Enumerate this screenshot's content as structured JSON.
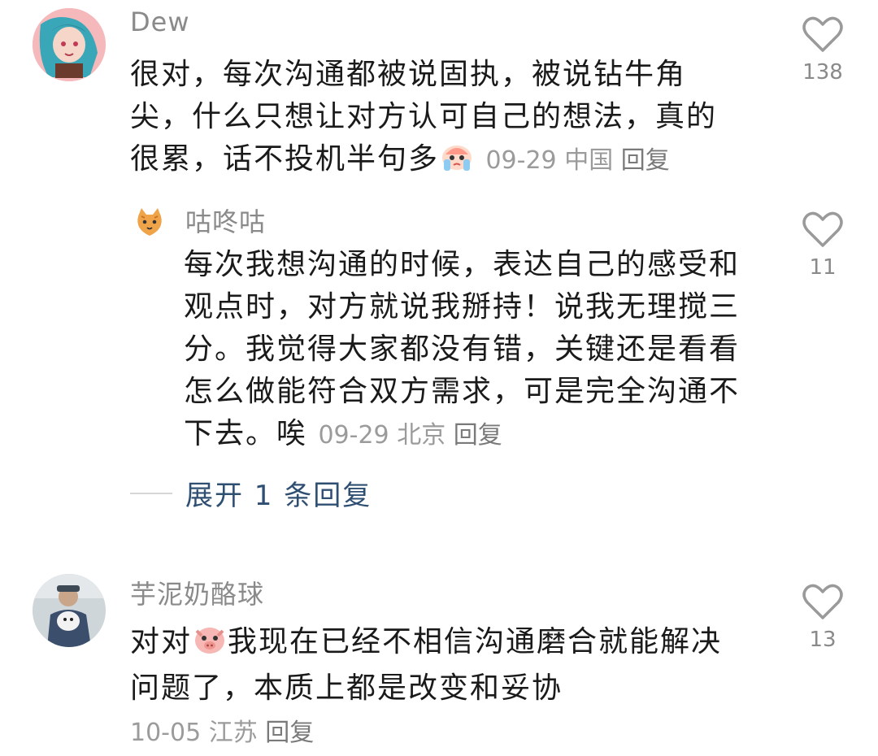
{
  "comments": [
    {
      "username": "Dew",
      "lines": [
        "很对，每次沟通都被说固执，被说钻牛角",
        "尖，什么只想让对方认可自己的想法，真的",
        "很累，话不投机半句多"
      ],
      "date": "09-29",
      "location": "中国",
      "reply_label": "回复",
      "likes": "138",
      "emoji": "crying-face-emoji",
      "avatar_icon": "anime-avatar-icon"
    },
    {
      "username": "咕咚咕",
      "lines": [
        "每次我想沟通的时候，表达自己的感受和",
        "观点时，对方就说我掰持！说我无理搅三",
        "分。我觉得大家都没有错，关键还是看看",
        "怎么做能符合双方需求，可是完全沟通不",
        "下去。唉"
      ],
      "date": "09-29",
      "location": "北京",
      "reply_label": "回复",
      "likes": "11",
      "avatar_icon": "cat-avatar-icon"
    },
    {
      "username": "芋泥奶酪球",
      "lines_a": "对对",
      "lines_b": "我现在已经不相信沟通磨合就能解决",
      "line2": "问题了，本质上都是改变和妥协",
      "date": "10-05",
      "location": "江苏",
      "reply_label": "回复",
      "likes": "13",
      "emoji": "pig-face-emoji",
      "avatar_icon": "photo-avatar-icon"
    }
  ],
  "expand_replies": "展开 1 条回复",
  "colors": {
    "link": "#2f4f72",
    "meta": "#9b9b9b",
    "heart": "#9a9a9a"
  }
}
